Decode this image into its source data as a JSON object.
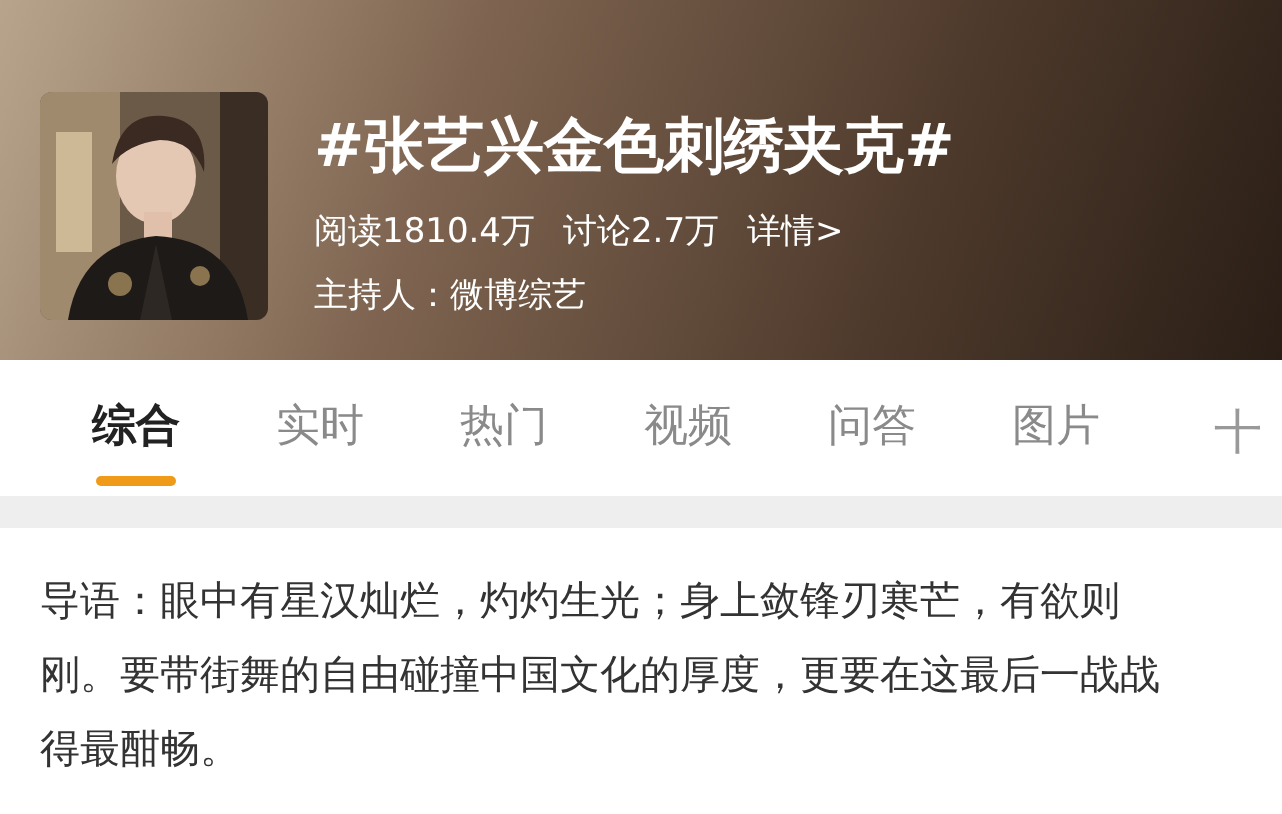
{
  "header": {
    "title": "#张艺兴金色刺绣夹克#",
    "stats": [
      {
        "label": "阅读1810.4万"
      },
      {
        "label": "讨论2.7万"
      },
      {
        "label": "详情>"
      }
    ],
    "host": "主持人：微博综艺"
  },
  "tabs": [
    {
      "label": "综合",
      "selected": true
    },
    {
      "label": "实时",
      "selected": false
    },
    {
      "label": "热门",
      "selected": false
    },
    {
      "label": "视频",
      "selected": false
    },
    {
      "label": "问答",
      "selected": false
    },
    {
      "label": "图片",
      "selected": false
    }
  ],
  "add_tab": "十",
  "intro": "导语：眼中有星汉灿烂，灼灼生光；身上敛锋刃寒芒，有欲则刚。要带街舞的自由碰撞中国文化的厚度，更要在这最后一战战得最酣畅。"
}
